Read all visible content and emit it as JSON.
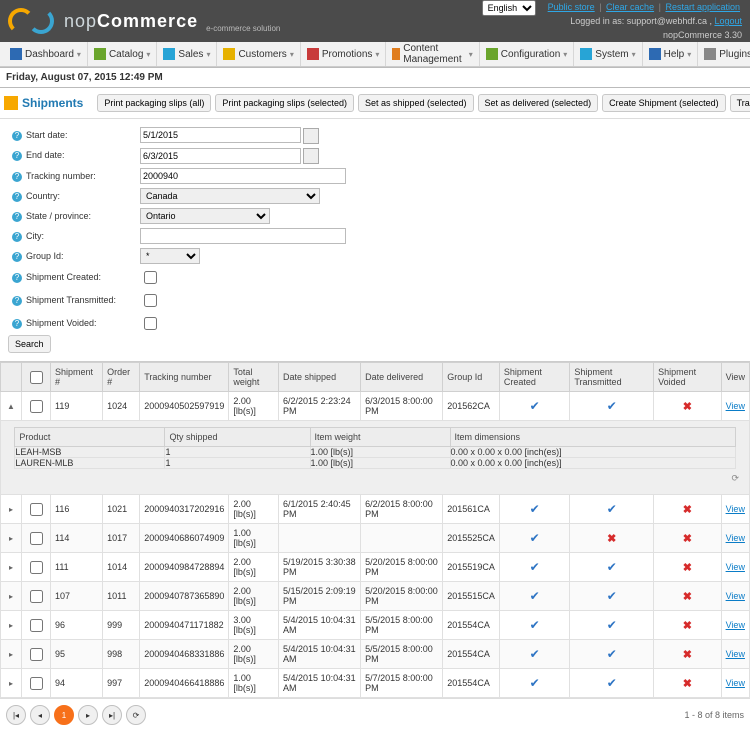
{
  "top_links": {
    "public_store": "Public store",
    "clear_cache": "Clear cache",
    "restart": "Restart application",
    "logged_in_prefix": "Logged in as: ",
    "user_email": "support@webhdf.ca",
    "logout": "Logout",
    "version": "nopCommerce 3.30",
    "lang_selected": "English"
  },
  "menu": [
    {
      "label": "Dashboard",
      "color": "#2d6ab3"
    },
    {
      "label": "Catalog",
      "color": "#6aa52c"
    },
    {
      "label": "Sales",
      "color": "#27a4d6"
    },
    {
      "label": "Customers",
      "color": "#e6b100"
    },
    {
      "label": "Promotions",
      "color": "#c83b3b"
    },
    {
      "label": "Content Management",
      "color": "#e07d1e"
    },
    {
      "label": "Configuration",
      "color": "#6aa52c"
    },
    {
      "label": "System",
      "color": "#27a4d6"
    },
    {
      "label": "Help",
      "color": "#2d6ab3"
    },
    {
      "label": "Plugins",
      "color": "#888"
    }
  ],
  "date_line": "Friday, August 07, 2015 12:49 PM",
  "page_title": "Shipments",
  "action_buttons": [
    "Print packaging slips (all)",
    "Print packaging slips (selected)",
    "Set as shipped (selected)",
    "Set as delivered (selected)",
    "Create Shipment (selected)",
    "Transmit & Get Manifest (selected)"
  ],
  "filters": {
    "start_date": {
      "label": "Start date:",
      "value": "5/1/2015"
    },
    "end_date": {
      "label": "End date:",
      "value": "6/3/2015"
    },
    "tracking": {
      "label": "Tracking number:",
      "value": "2000940"
    },
    "country": {
      "label": "Country:",
      "value": "Canada"
    },
    "state": {
      "label": "State / province:",
      "value": "Ontario"
    },
    "city": {
      "label": "City:",
      "value": ""
    },
    "group": {
      "label": "Group Id:",
      "value": "*"
    },
    "created": {
      "label": "Shipment Created:"
    },
    "transmitted": {
      "label": "Shipment Transmitted:"
    },
    "voided": {
      "label": "Shipment Voided:"
    },
    "search_btn": "Search"
  },
  "columns": [
    "Shipment #",
    "Order #",
    "Tracking number",
    "Total weight",
    "Date shipped",
    "Date delivered",
    "Group Id",
    "Shipment Created",
    "Shipment Transmitted",
    "Shipment Voided",
    "View"
  ],
  "rows": [
    {
      "expand": "▲",
      "sid": "119",
      "oid": "1024",
      "track": "2000940502597919",
      "weight": "2.00 [lb(s)]",
      "shipped": "6/2/2015 2:23:24 PM",
      "delivered": "6/3/2015 8:00:00 PM",
      "group": "201562CA",
      "created": "✓",
      "transmitted": "✓",
      "voided": "✗",
      "view": "View"
    },
    {
      "expand": "▸",
      "sid": "116",
      "oid": "1021",
      "track": "2000940317202916",
      "weight": "2.00 [lb(s)]",
      "shipped": "6/1/2015 2:40:45 PM",
      "delivered": "6/2/2015 8:00:00 PM",
      "group": "201561CA",
      "created": "✓",
      "transmitted": "✓",
      "voided": "✗",
      "view": "View"
    },
    {
      "expand": "▸",
      "sid": "114",
      "oid": "1017",
      "track": "2000940686074909",
      "weight": "1.00 [lb(s)]",
      "shipped": "",
      "delivered": "",
      "group": "2015525CA",
      "created": "✓",
      "transmitted": "✗",
      "voided": "✗",
      "view": "View"
    },
    {
      "expand": "▸",
      "sid": "111",
      "oid": "1014",
      "track": "2000940984728894",
      "weight": "2.00 [lb(s)]",
      "shipped": "5/19/2015 3:30:38 PM",
      "delivered": "5/20/2015 8:00:00 PM",
      "group": "2015519CA",
      "created": "✓",
      "transmitted": "✓",
      "voided": "✗",
      "view": "View"
    },
    {
      "expand": "▸",
      "sid": "107",
      "oid": "1011",
      "track": "2000940787365890",
      "weight": "2.00 [lb(s)]",
      "shipped": "5/15/2015 2:09:19 PM",
      "delivered": "5/20/2015 8:00:00 PM",
      "group": "2015515CA",
      "created": "✓",
      "transmitted": "✓",
      "voided": "✗",
      "view": "View"
    },
    {
      "expand": "▸",
      "sid": "96",
      "oid": "999",
      "track": "2000940471171882",
      "weight": "3.00 [lb(s)]",
      "shipped": "5/4/2015 10:04:31 AM",
      "delivered": "5/5/2015 8:00:00 PM",
      "group": "201554CA",
      "created": "✓",
      "transmitted": "✓",
      "voided": "✗",
      "view": "View"
    },
    {
      "expand": "▸",
      "sid": "95",
      "oid": "998",
      "track": "2000940468331886",
      "weight": "2.00 [lb(s)]",
      "shipped": "5/4/2015 10:04:31 AM",
      "delivered": "5/5/2015 8:00:00 PM",
      "group": "201554CA",
      "created": "✓",
      "transmitted": "✓",
      "voided": "✗",
      "view": "View"
    },
    {
      "expand": "▸",
      "sid": "94",
      "oid": "997",
      "track": "2000940466418886",
      "weight": "1.00 [lb(s)]",
      "shipped": "5/4/2015 10:04:31 AM",
      "delivered": "5/7/2015 8:00:00 PM",
      "group": "201554CA",
      "created": "✓",
      "transmitted": "✓",
      "voided": "✗",
      "view": "View"
    }
  ],
  "subgrid": {
    "columns": [
      "Product",
      "Qty shipped",
      "Item weight",
      "Item dimensions"
    ],
    "rows": [
      {
        "product": "LEAH-MSB",
        "qty": "1",
        "weight": "1.00 [lb(s)]",
        "dim": "0.00 x 0.00 x 0.00 [inch(es)]"
      },
      {
        "product": "LAUREN-MLB",
        "qty": "1",
        "weight": "1.00 [lb(s)]",
        "dim": "0.00 x 0.00 x 0.00 [inch(es)]"
      }
    ],
    "refresh": "⟳"
  },
  "pager": {
    "current": "1",
    "info": "1 - 8 of 8 items"
  }
}
